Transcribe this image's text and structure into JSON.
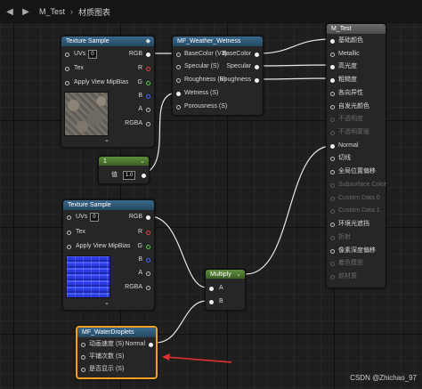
{
  "tab": {
    "name": "M_Test",
    "breadcrumb": "材质图表"
  },
  "colors": {
    "red_arrow": "#e03030",
    "selected_border": "#f0a020"
  },
  "texture_sample_1": {
    "title": "Texture Sample",
    "inputs": [
      "UVs",
      "Tex",
      "Apply View MipBias"
    ],
    "uvs_value": "0",
    "outputs": [
      "RGB",
      "R",
      "G",
      "B",
      "A",
      "RGBA"
    ],
    "texture_icon": "stone-texture"
  },
  "weather_wetness": {
    "title": "MF_Weather_Wetness",
    "inputs": [
      "BaseColor (V3)",
      "Specular (S)",
      "Roughness (S)",
      "Wetness (S)",
      "Porousness (S)"
    ],
    "outputs": [
      "BaseColor",
      "Specular",
      "Roughness"
    ]
  },
  "scalar_param": {
    "title": "1",
    "label": "值",
    "value": "1.0"
  },
  "texture_sample_2": {
    "title": "Texture Sample",
    "inputs": [
      "UVs",
      "Tex",
      "Apply View MipBias"
    ],
    "uvs_value": "0",
    "outputs": [
      "RGB",
      "R",
      "G",
      "B",
      "A",
      "RGBA"
    ],
    "texture_icon": "water-normal-texture"
  },
  "multiply": {
    "title": "Multiply",
    "inputs": [
      "A",
      "B"
    ]
  },
  "water_droplets": {
    "title": "MF_WaterDroplets",
    "inputs": [
      "动画速度 (S)",
      "平铺次数 (S)",
      "是否显示 (S)"
    ],
    "output": "Normal"
  },
  "result_node": {
    "title": "M_Test",
    "pins": [
      {
        "label": "基础颜色",
        "active": true
      },
      {
        "label": "Metallic",
        "active": true
      },
      {
        "label": "高光度",
        "active": true
      },
      {
        "label": "粗糙度",
        "active": true
      },
      {
        "label": "各向异性",
        "active": true
      },
      {
        "label": "自发光颜色",
        "active": true
      },
      {
        "label": "不透明度",
        "active": false
      },
      {
        "label": "不透明蒙版",
        "active": false
      },
      {
        "label": "Normal",
        "active": true
      },
      {
        "label": "切线",
        "active": true
      },
      {
        "label": "全局位置偏移",
        "active": true
      },
      {
        "label": "Subsurface Color",
        "active": false
      },
      {
        "label": "Custom Data 0",
        "active": false
      },
      {
        "label": "Custom Data 1",
        "active": false
      },
      {
        "label": "环境光遮挡",
        "active": true
      },
      {
        "label": "折射",
        "active": false
      },
      {
        "label": "像素深度偏移",
        "active": true
      },
      {
        "label": "着色模型",
        "active": false
      },
      {
        "label": "前材质",
        "active": false
      }
    ]
  },
  "watermark": "CSDN @Zhichao_97"
}
